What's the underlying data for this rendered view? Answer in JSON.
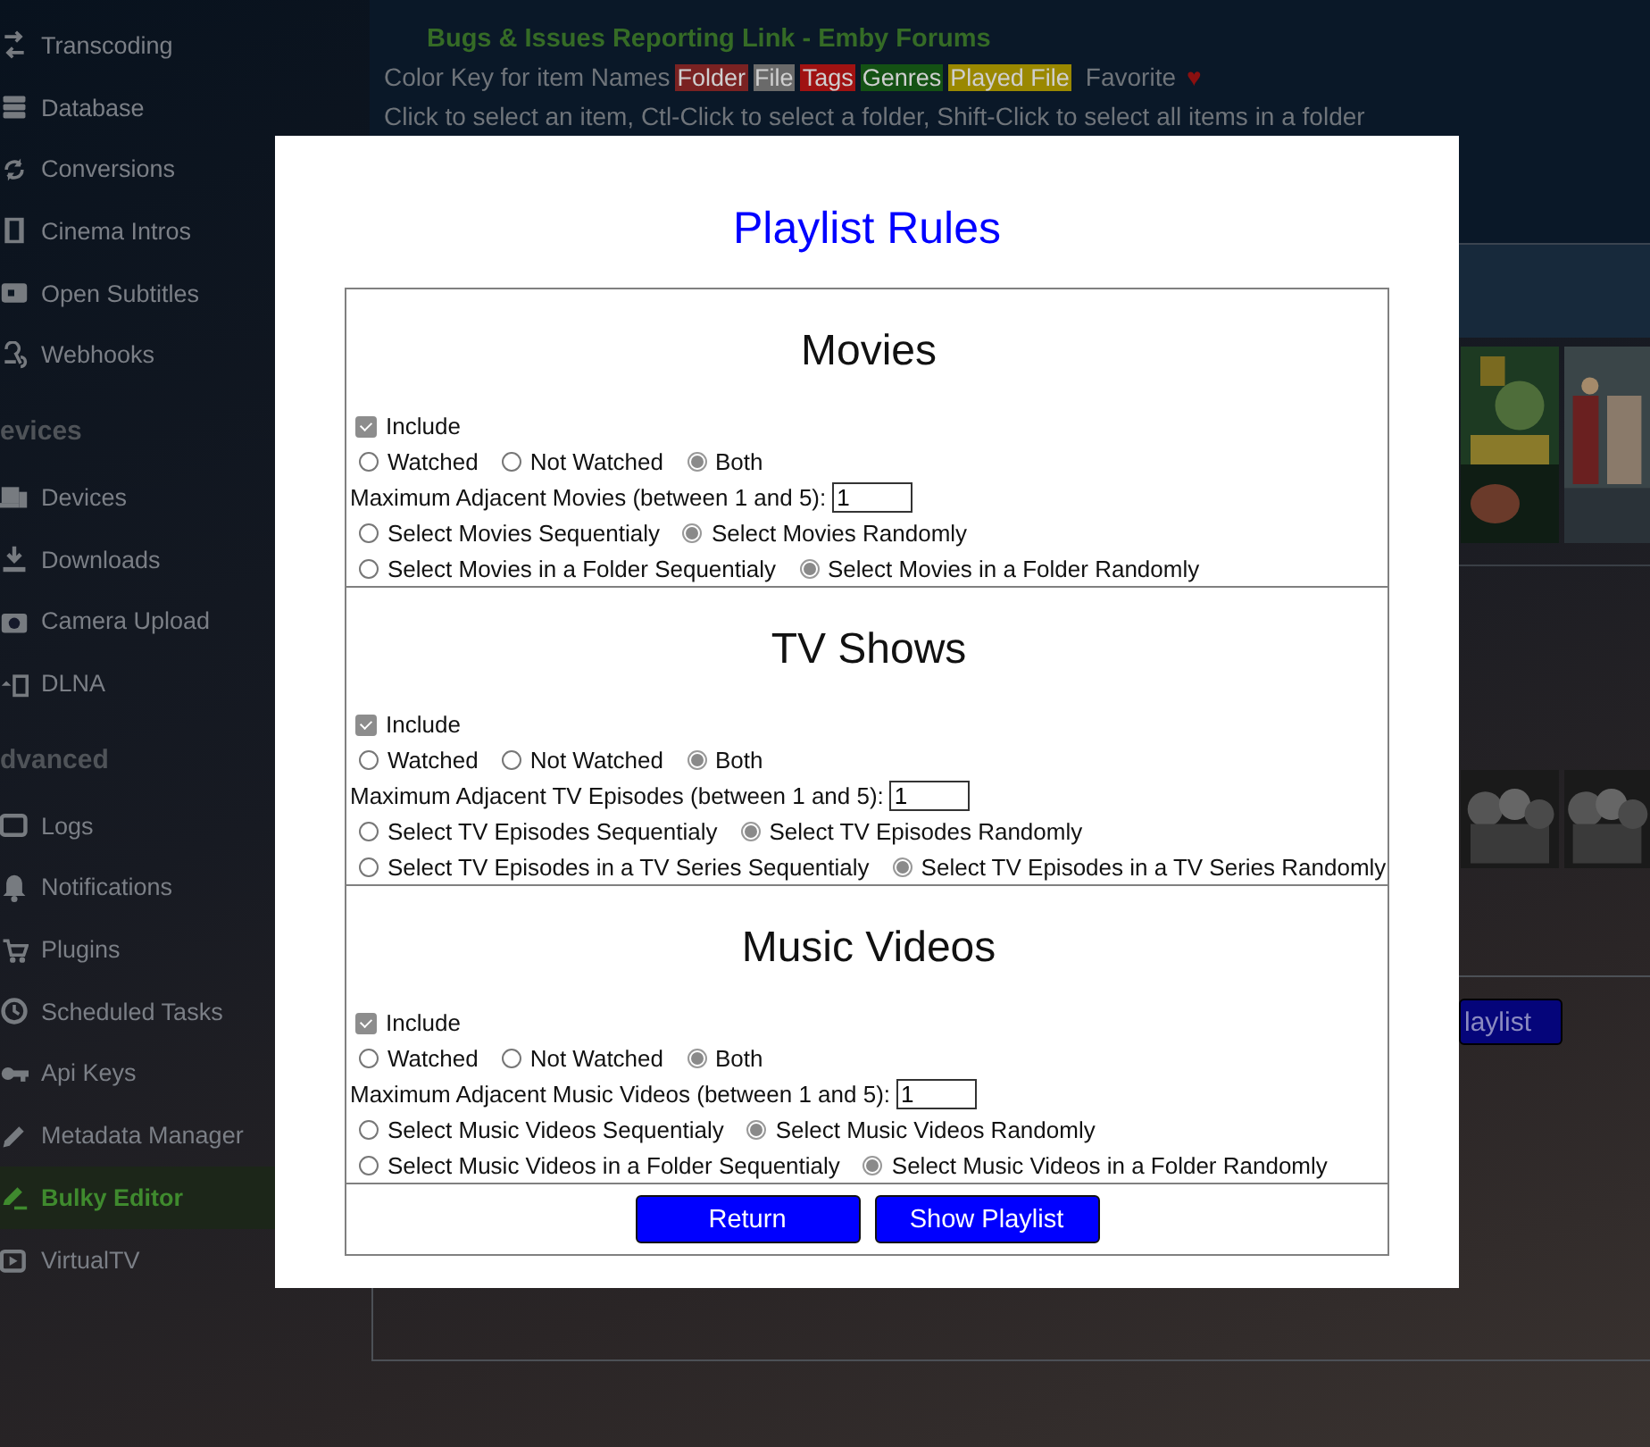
{
  "sidebar": {
    "items": [
      {
        "kind": "item",
        "label": "Transcoding",
        "selected": false
      },
      {
        "kind": "item",
        "label": "Database",
        "selected": false
      },
      {
        "kind": "item",
        "label": "Conversions",
        "selected": false
      },
      {
        "kind": "item",
        "label": "Cinema Intros",
        "selected": false
      },
      {
        "kind": "item",
        "label": "Open Subtitles",
        "selected": false
      },
      {
        "kind": "item",
        "label": "Webhooks",
        "selected": false
      },
      {
        "kind": "header",
        "label": "evices"
      },
      {
        "kind": "item",
        "label": "Devices",
        "selected": false
      },
      {
        "kind": "item",
        "label": "Downloads",
        "selected": false
      },
      {
        "kind": "item",
        "label": "Camera Upload",
        "selected": false
      },
      {
        "kind": "item",
        "label": "DLNA",
        "selected": false
      },
      {
        "kind": "header",
        "label": "dvanced"
      },
      {
        "kind": "item",
        "label": "Logs",
        "selected": false
      },
      {
        "kind": "item",
        "label": "Notifications",
        "selected": false
      },
      {
        "kind": "item",
        "label": "Plugins",
        "selected": false
      },
      {
        "kind": "item",
        "label": "Scheduled Tasks",
        "selected": false
      },
      {
        "kind": "item",
        "label": "Api Keys",
        "selected": false
      },
      {
        "kind": "item",
        "label": "Metadata Manager",
        "selected": false
      },
      {
        "kind": "item",
        "label": "Bulky Editor",
        "selected": true
      },
      {
        "kind": "item",
        "label": "VirtualTV",
        "selected": false
      }
    ]
  },
  "header": {
    "link": "Bugs & Issues Reporting Link - Emby Forums",
    "color_key_label": "Color Key for item Names",
    "color_key": [
      {
        "label": "Folder",
        "color": "#7a2222"
      },
      {
        "label": "File",
        "color": "#6a6a6a"
      },
      {
        "label": "Tags",
        "color": "#a01212"
      },
      {
        "label": "Genres",
        "color": "#145214"
      },
      {
        "label": "Played File",
        "color": "#9a8800"
      }
    ],
    "favorite_label": "Favorite",
    "favorite_mark": "♥",
    "hint": "Click to select an item, Ctl-Click to select a folder, Shift-Click to select all items in a folder"
  },
  "background_button": {
    "label": "laylist"
  },
  "dialog": {
    "title": "Playlist Rules",
    "sections": [
      {
        "heading": "Movies",
        "include": {
          "label": "Include",
          "checked": true
        },
        "watched_options": [
          {
            "label": "Watched",
            "selected": false
          },
          {
            "label": "Not Watched",
            "selected": false
          },
          {
            "label": "Both",
            "selected": true
          }
        ],
        "max_adjacent": {
          "label": "Maximum Adjacent Movies (between 1 and 5):",
          "value": "1"
        },
        "order_options": [
          {
            "label": "Select Movies Sequentialy",
            "selected": false
          },
          {
            "label": "Select Movies Randomly",
            "selected": true
          }
        ],
        "folder_order_options": [
          {
            "label": "Select Movies in a Folder Sequentialy",
            "selected": false
          },
          {
            "label": "Select Movies in a Folder Randomly",
            "selected": true
          }
        ]
      },
      {
        "heading": "TV Shows",
        "include": {
          "label": "Include",
          "checked": true
        },
        "watched_options": [
          {
            "label": "Watched",
            "selected": false
          },
          {
            "label": "Not Watched",
            "selected": false
          },
          {
            "label": "Both",
            "selected": true
          }
        ],
        "max_adjacent": {
          "label": "Maximum Adjacent TV Episodes (between 1 and 5):",
          "value": "1"
        },
        "order_options": [
          {
            "label": "Select TV Episodes Sequentialy",
            "selected": false
          },
          {
            "label": "Select TV Episodes Randomly",
            "selected": true
          }
        ],
        "folder_order_options": [
          {
            "label": "Select TV Episodes in a TV Series Sequentialy",
            "selected": false
          },
          {
            "label": "Select TV Episodes in a TV Series Randomly",
            "selected": true
          }
        ]
      },
      {
        "heading": "Music Videos",
        "include": {
          "label": "Include",
          "checked": true
        },
        "watched_options": [
          {
            "label": "Watched",
            "selected": false
          },
          {
            "label": "Not Watched",
            "selected": false
          },
          {
            "label": "Both",
            "selected": true
          }
        ],
        "max_adjacent": {
          "label": "Maximum Adjacent Music Videos (between 1 and 5):",
          "value": "1"
        },
        "order_options": [
          {
            "label": "Select Music Videos Sequentialy",
            "selected": false
          },
          {
            "label": "Select Music Videos Randomly",
            "selected": true
          }
        ],
        "folder_order_options": [
          {
            "label": "Select Music Videos in a Folder Sequentialy",
            "selected": false
          },
          {
            "label": "Select Music Videos in a Folder Randomly",
            "selected": true
          }
        ]
      }
    ],
    "buttons": [
      {
        "label": "Return"
      },
      {
        "label": "Show Playlist"
      }
    ]
  }
}
